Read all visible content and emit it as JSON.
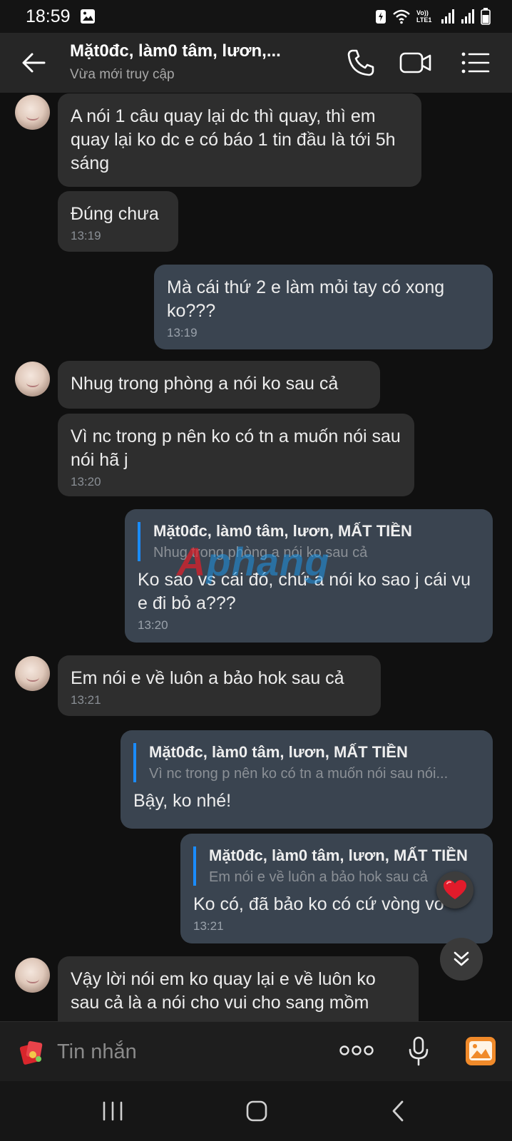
{
  "status_bar": {
    "time": "18:59",
    "network": "Vo)) LTE1"
  },
  "header": {
    "title": "Mặt0đc, làm0 tâm, lươn,...",
    "subtitle": "Vừa mới truy cập",
    "icons": [
      "back-arrow-icon",
      "phone-icon",
      "video-call-icon",
      "menu-list-icon"
    ]
  },
  "messages": [
    {
      "id": "m1",
      "direction": "in",
      "text": "A nói 1 câu quay lại dc thì quay, thì em quay lại ko dc e có báo 1 tin đầu là tới 5h sáng"
    },
    {
      "id": "m2",
      "direction": "in",
      "text": "Đúng chưa",
      "time": "13:19"
    },
    {
      "id": "m3",
      "direction": "out",
      "text": "Mà cái thứ 2 e làm mỏi tay có xong ko???",
      "time": "13:19"
    },
    {
      "id": "m4",
      "direction": "in",
      "text": "Nhug trong phòng a nói ko sau cả"
    },
    {
      "id": "m5",
      "direction": "in",
      "text": "Vì nc trong p nên ko có tn a muốn nói sau nói hã j",
      "time": "13:20"
    },
    {
      "id": "m6",
      "direction": "out",
      "quote_name": "Mặt0đc, làm0 tâm, lươn, MẤT TIỀN",
      "quote_text": "Nhug trong phòng a nói ko sau cả",
      "text": "Ko sao vs cái đó, chứ a nói ko sao j cái vụ e đi bỏ a???",
      "time": "13:20"
    },
    {
      "id": "m7",
      "direction": "in",
      "text": "Em nói e về luôn a bảo hok sau cả",
      "time": "13:21"
    },
    {
      "id": "m8",
      "direction": "out",
      "quote_name": "Mặt0đc, làm0 tâm, lươn, MẤT TIỀN",
      "quote_text": "Vì nc trong p nên ko có tn a muốn nói sau nói...",
      "text": "Bậy, ko nhé!"
    },
    {
      "id": "m9",
      "direction": "out",
      "quote_name": "Mặt0đc, làm0 tâm, lươn, MẤT TIỀN",
      "quote_text": "Em nói e về luôn a bảo hok sau cả",
      "text": "Ko có, đã bảo ko có cứ vòng vo",
      "time": "13:21",
      "reaction": "heart"
    },
    {
      "id": "m10",
      "direction": "in",
      "text": "Vậy lời nói em ko quay lại e về luôn ko sau cả là a nói cho vui cho sang mồm"
    }
  ],
  "watermark": {
    "part1": "A",
    "part2": "phang"
  },
  "input": {
    "placeholder": "Tin nhắn",
    "value": ""
  },
  "colors": {
    "incoming_bubble": "#2e2e2e",
    "outgoing_bubble": "#3a4450",
    "quote_bar": "#1a8cff",
    "gallery_accent": "#f08a2a"
  }
}
